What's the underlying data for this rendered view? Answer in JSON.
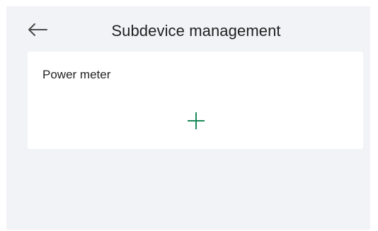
{
  "header": {
    "title": "Subdevice management",
    "back_icon": "arrow-left-icon"
  },
  "card": {
    "title": "Power meter",
    "add_icon": "plus-icon",
    "accent_color": "#1a8a5a"
  },
  "colors": {
    "background": "#f2f3f7",
    "card": "#ffffff",
    "text": "#1f1f1f"
  }
}
